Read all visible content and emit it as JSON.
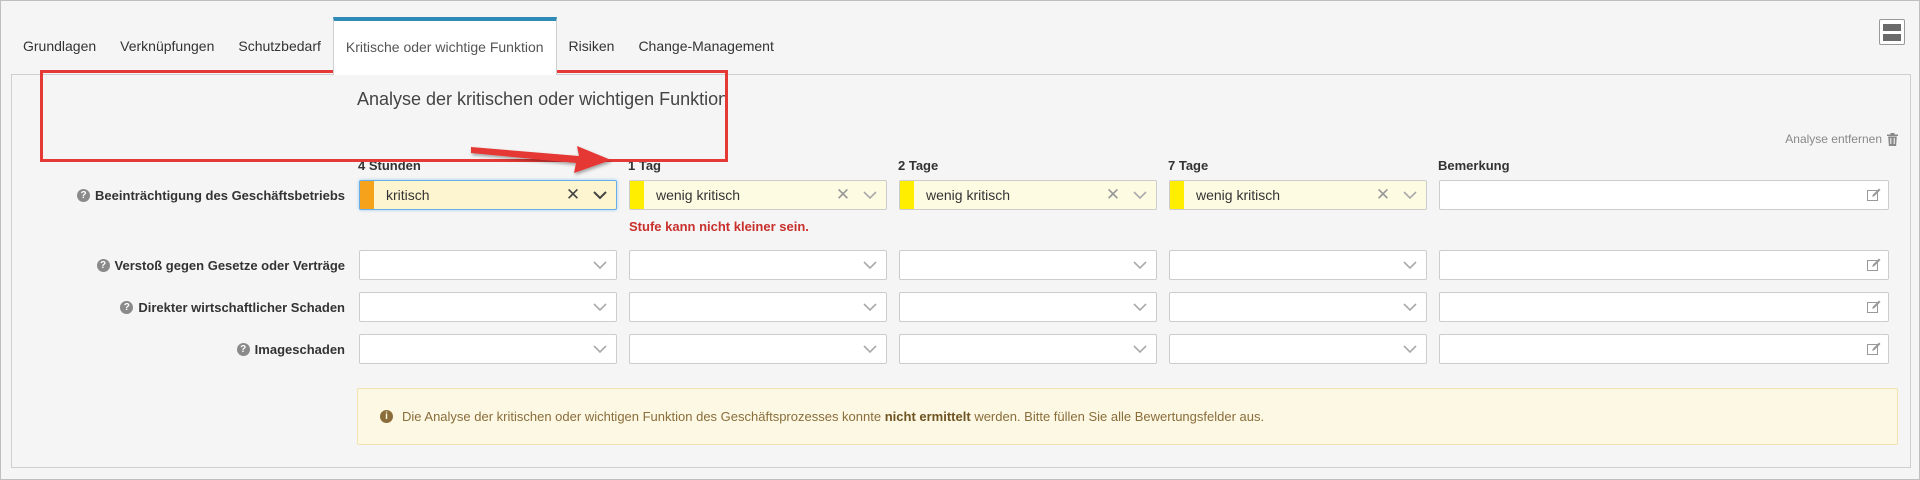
{
  "tabs": [
    {
      "label": "Grundlagen",
      "active": false
    },
    {
      "label": "Verknüpfungen",
      "active": false
    },
    {
      "label": "Schutzbedarf",
      "active": false
    },
    {
      "label": "Kritische oder wichtige Funktion",
      "active": true
    },
    {
      "label": "Risiken",
      "active": false
    },
    {
      "label": "Change-Management",
      "active": false
    }
  ],
  "panel": {
    "title": "Analyse der kritischen oder wichtigen Funktion",
    "remove_label": "Analyse entfernen"
  },
  "columns": [
    "4 Stunden",
    "1 Tag",
    "2 Tage",
    "7 Tage",
    "Bemerkung"
  ],
  "rows": [
    {
      "label": "Beeinträchtigung des Geschäftsbetriebs",
      "cells": [
        {
          "value": "kritisch",
          "color": "#f7a21b"
        },
        {
          "value": "wenig kritisch",
          "color": "#ffee00"
        },
        {
          "value": "wenig kritisch",
          "color": "#ffee00"
        },
        {
          "value": "wenig kritisch",
          "color": "#ffee00"
        }
      ],
      "error": "Stufe kann nicht kleiner sein."
    },
    {
      "label": "Verstoß gegen Gesetze oder Verträge"
    },
    {
      "label": "Direkter wirtschaftlicher Schaden"
    },
    {
      "label": "Imageschaden"
    }
  ],
  "alert": {
    "prefix": "Die Analyse der kritischen oder wichtigen Funktion des Geschäftsprozesses konnte",
    "bold": "nicht ermittelt",
    "suffix": "werden. Bitte füllen Sie alle Bewertungsfelder aus."
  },
  "icons": {
    "help": "question-circle-icon",
    "trash": "trash-icon",
    "edit": "edit-icon",
    "info": "info-circle-icon",
    "chevron": "chevron-down-icon",
    "clear": "clear-x-icon"
  },
  "colors": {
    "accent": "#2e8bb8",
    "error": "#c9302c",
    "annotation": "#e53935"
  }
}
